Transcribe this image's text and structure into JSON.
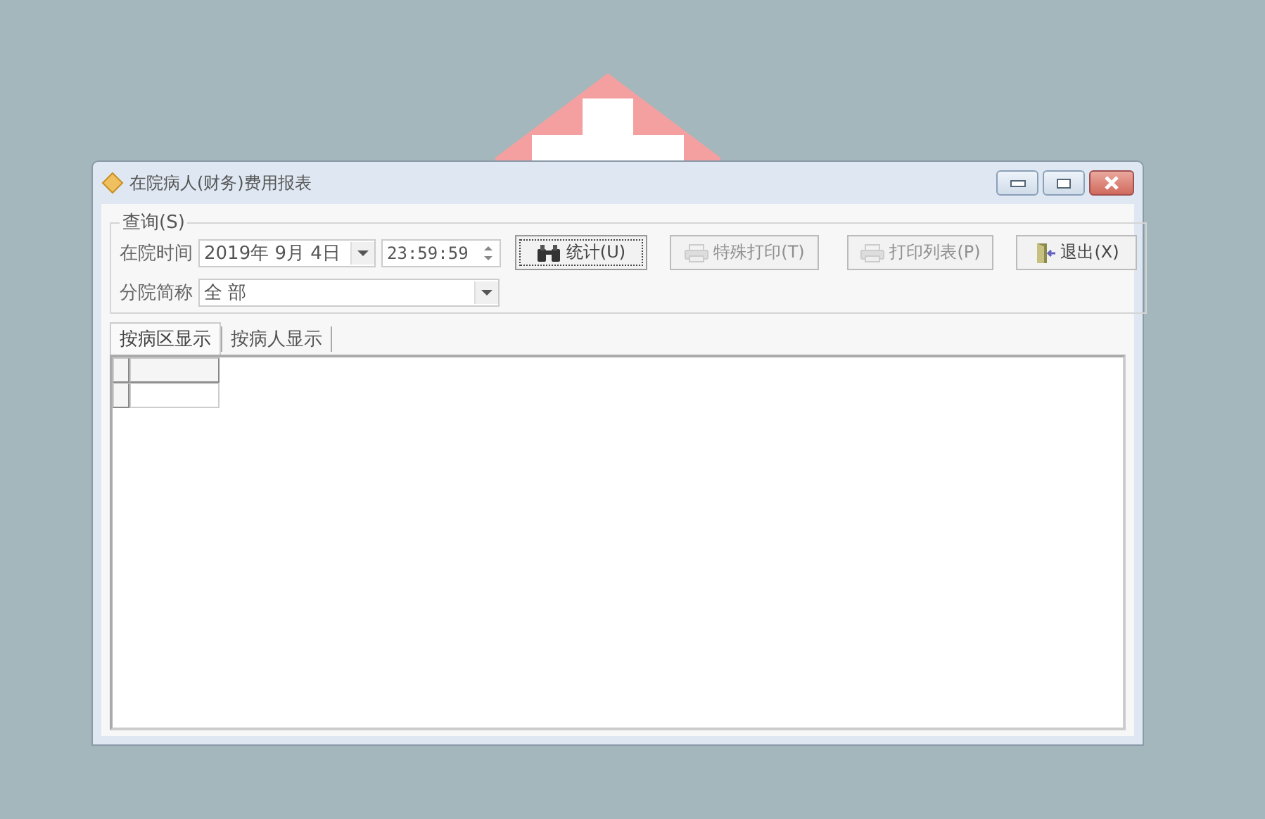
{
  "window": {
    "title": "在院病人(财务)费用报表"
  },
  "query": {
    "legend": "查询(S)",
    "date_label": "在院时间",
    "date_value": "2019年 9月 4日",
    "time_value": "23:59:59",
    "branch_label": "分院简称",
    "branch_value": "全 部"
  },
  "buttons": [
    {
      "label": "统计(U)",
      "kind": "binoculars",
      "disabled": false
    },
    {
      "label": "特殊打印(T)",
      "kind": "printer",
      "disabled": true
    },
    {
      "label": "打印列表(P)",
      "kind": "printer",
      "disabled": true
    },
    {
      "label": "退出(X)",
      "kind": "exit",
      "disabled": false
    }
  ],
  "tabs": [
    {
      "label": "按病区显示",
      "selected": true
    },
    {
      "label": "按病人显示",
      "selected": false
    }
  ]
}
